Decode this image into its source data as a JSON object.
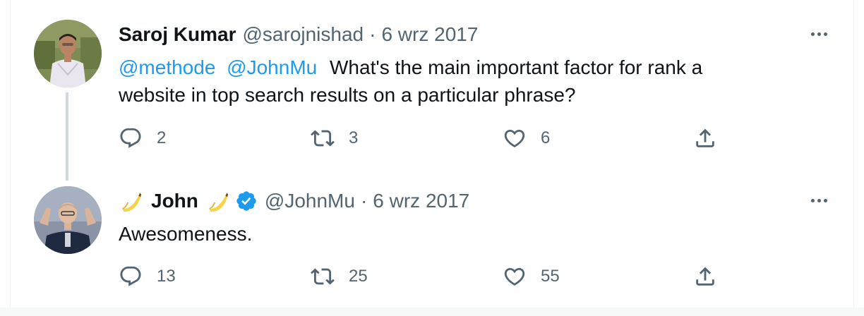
{
  "tweets": [
    {
      "name": "Saroj Kumar",
      "handle": "@sarojnishad",
      "separator": "·",
      "date": "6 wrz 2017",
      "mention1": "@methode",
      "mention2": "@JohnMu",
      "text_line1": "What's the main important factor for rank a",
      "text_line2": "website in top search results on a particular phrase?",
      "replies": "2",
      "retweets": "3",
      "likes": "6"
    },
    {
      "name": "John",
      "handle": "@JohnMu",
      "separator": "·",
      "date": "6 wrz 2017",
      "text": "Awesomeness.",
      "replies": "13",
      "retweets": "25",
      "likes": "55",
      "verified": true
    }
  ],
  "icons": {
    "reply": "reply-icon",
    "retweet": "retweet-icon",
    "like": "heart-icon",
    "share": "share-icon",
    "more": "more-icon",
    "verified": "verified-badge-icon",
    "emoji": "banana-emoji-icon"
  },
  "colors": {
    "text": "#0f1419",
    "muted": "#536471",
    "accent": "#1d9bf0",
    "thread_line": "#cfd9de"
  }
}
